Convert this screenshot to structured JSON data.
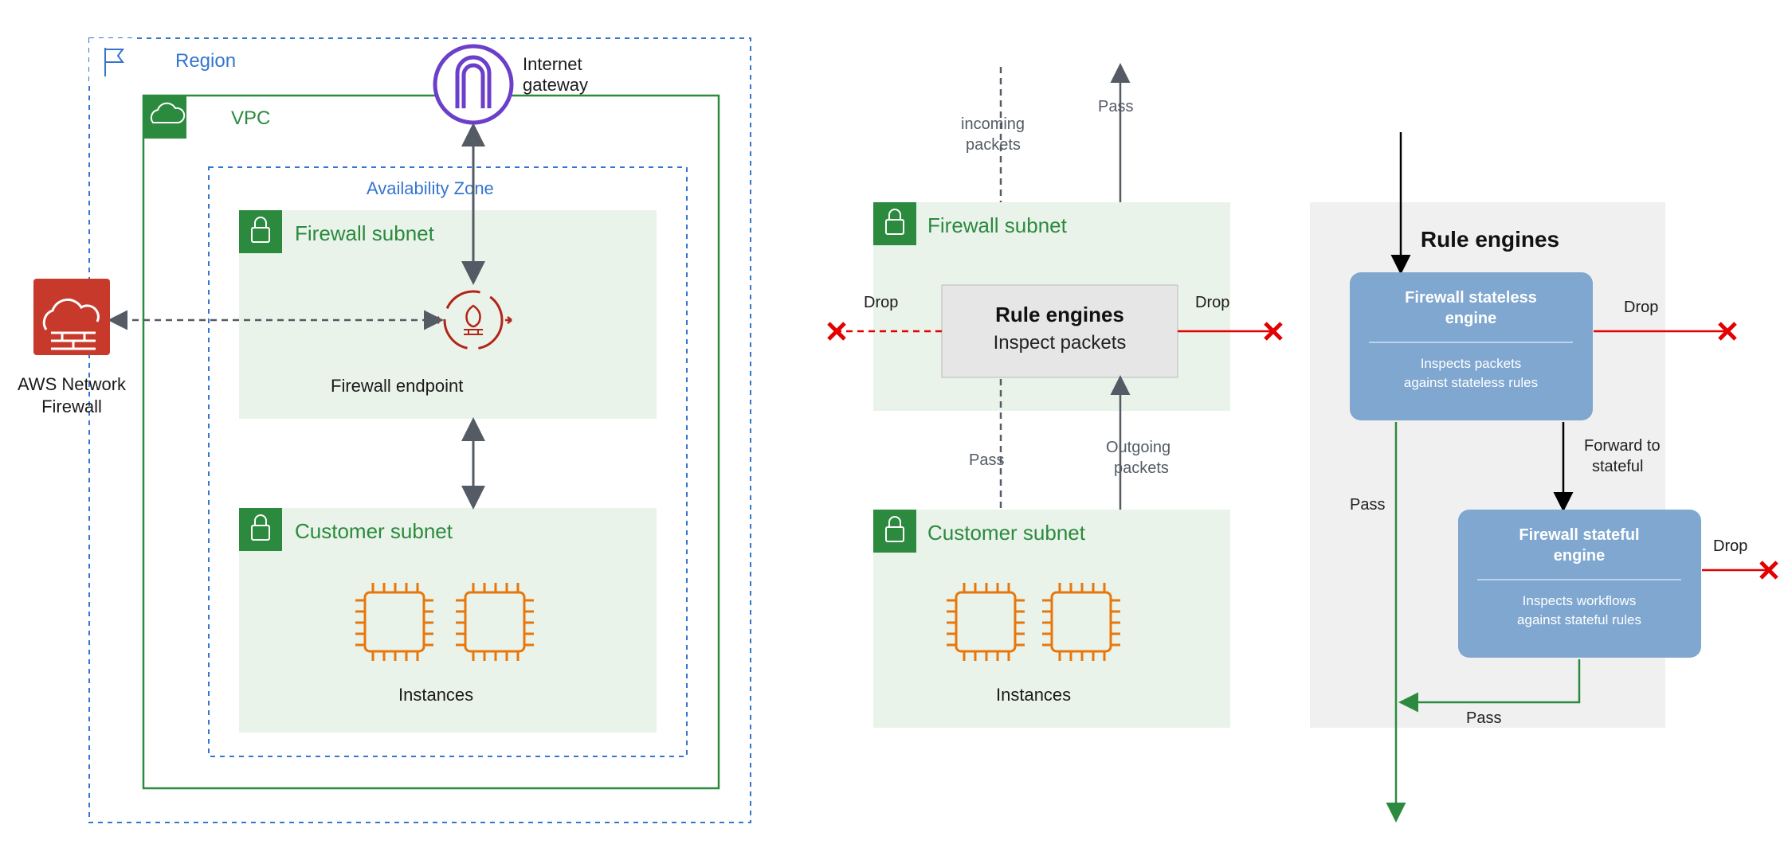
{
  "panel1": {
    "region_label": "Region",
    "vpc_label": "VPC",
    "az_label": "Availability Zone",
    "internet_gateway_label": "Internet\ngateway",
    "firewall_subnet_label": "Firewall subnet",
    "firewall_endpoint_label": "Firewall endpoint",
    "customer_subnet_label": "Customer subnet",
    "instances_label": "Instances",
    "aws_nfw_label": "AWS Network\nFirewall"
  },
  "panel2": {
    "incoming_label": "incoming\npackets",
    "pass_up_label": "Pass",
    "firewall_subnet_label": "Firewall subnet",
    "drop_left_label": "Drop",
    "drop_right_label": "Drop",
    "rule_engines_title": "Rule engines",
    "rule_engines_sub": "Inspect packets",
    "pass_down_label": "Pass",
    "outgoing_label": "Outgoing\npackets",
    "customer_subnet_label": "Customer subnet",
    "instances_label": "Instances"
  },
  "panel3": {
    "title": "Rule engines",
    "stateless_title": "Firewall stateless\nengine",
    "stateless_sub": "Inspects packets\nagainst stateless rules",
    "stateful_title": "Firewall stateful\nengine",
    "stateful_sub": "Inspects workflows\nagainst stateful rules",
    "drop1_label": "Drop",
    "drop2_label": "Drop",
    "forward_label": "Forward to\nstateful",
    "pass1_label": "Pass",
    "pass2_label": "Pass"
  }
}
